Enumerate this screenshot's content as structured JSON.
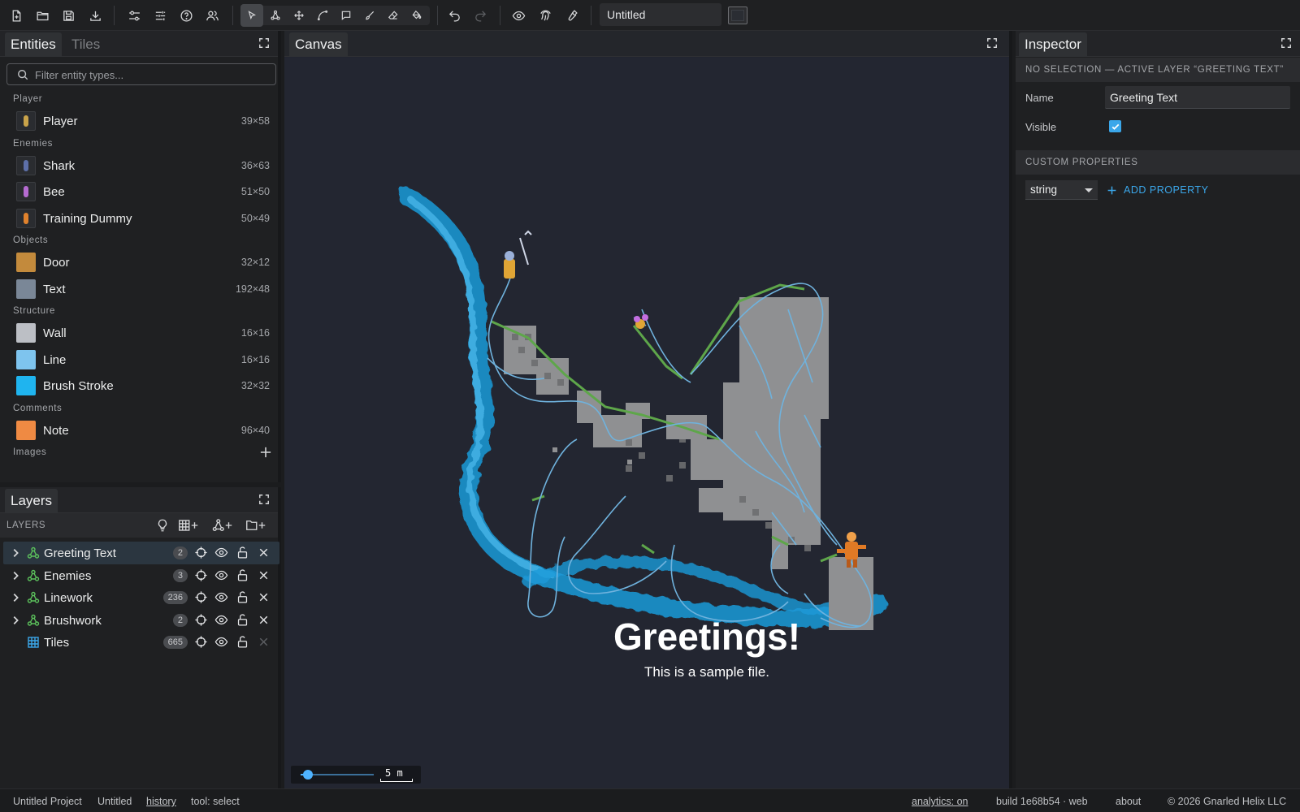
{
  "toolbar": {
    "document_name": "Untitled",
    "icons": [
      "new-file-icon",
      "open-folder-icon",
      "save-icon",
      "download-icon",
      "sliders-icon",
      "tune-icon",
      "help-icon",
      "users-icon",
      "select-pointer-icon",
      "node-tool-icon",
      "pan-icon",
      "curve-tool-icon",
      "comment-tool-icon",
      "brush-icon",
      "eraser-icon",
      "fill-icon",
      "undo-icon",
      "redo-icon",
      "eye-icon",
      "fingerprint-icon",
      "wrench-icon"
    ],
    "active_tool": "select"
  },
  "entities_panel": {
    "tabs": [
      {
        "label": "Entities",
        "active": true
      },
      {
        "label": "Tiles",
        "active": false
      }
    ],
    "filter_placeholder": "Filter entity types...",
    "categories": [
      {
        "label": "Player",
        "items": [
          {
            "name": "Player",
            "size": "39×58",
            "thumb": "sprite",
            "color": "#c9a34a"
          }
        ]
      },
      {
        "label": "Enemies",
        "items": [
          {
            "name": "Shark",
            "size": "36×63",
            "thumb": "sprite",
            "color": "#5d6fa8"
          },
          {
            "name": "Bee",
            "size": "51×50",
            "thumb": "sprite",
            "color": "#b56bd1"
          },
          {
            "name": "Training Dummy",
            "size": "50×49",
            "thumb": "sprite",
            "color": "#e0822d"
          }
        ]
      },
      {
        "label": "Objects",
        "items": [
          {
            "name": "Door",
            "size": "32×12",
            "thumb": "swatch",
            "color": "#c38a3c"
          },
          {
            "name": "Text",
            "size": "192×48",
            "thumb": "swatch",
            "color": "#7a8797"
          }
        ]
      },
      {
        "label": "Structure",
        "items": [
          {
            "name": "Wall",
            "size": "16×16",
            "thumb": "swatch",
            "color": "#bcbfc5"
          },
          {
            "name": "Line",
            "size": "16×16",
            "thumb": "swatch",
            "color": "#7ec4ee"
          },
          {
            "name": "Brush Stroke",
            "size": "32×32",
            "thumb": "swatch",
            "color": "#1fb4ef"
          }
        ]
      },
      {
        "label": "Comments",
        "items": [
          {
            "name": "Note",
            "size": "96×40",
            "thumb": "swatch",
            "color": "#ef8a43"
          }
        ]
      },
      {
        "label": "Images",
        "items": []
      }
    ]
  },
  "layers_panel": {
    "title": "Layers",
    "heading": "LAYERS",
    "layers": [
      {
        "name": "Greeting Text",
        "count": "2",
        "type": "entity",
        "active": true,
        "deletable": true,
        "expandable": true
      },
      {
        "name": "Enemies",
        "count": "3",
        "type": "entity",
        "active": false,
        "deletable": true,
        "expandable": true
      },
      {
        "name": "Linework",
        "count": "236",
        "type": "entity",
        "active": false,
        "deletable": true,
        "expandable": true
      },
      {
        "name": "Brushwork",
        "count": "2",
        "type": "entity",
        "active": false,
        "deletable": true,
        "expandable": true
      },
      {
        "name": "Tiles",
        "count": "665",
        "type": "tile",
        "active": false,
        "deletable": false,
        "expandable": false
      }
    ],
    "colors": {
      "entity_icon": "#5cc25c",
      "tile_icon": "#3ba7ea"
    }
  },
  "canvas": {
    "title": "Canvas",
    "greeting_title": "Greetings!",
    "greeting_subtitle": "This is a sample file.",
    "scale_label": "5 m",
    "zoom_level": 0.1
  },
  "inspector": {
    "title": "Inspector",
    "selection_status": "NO SELECTION — ACTIVE LAYER “GREETING TEXT”",
    "name_label": "Name",
    "name_value": "Greeting Text",
    "visible_label": "Visible",
    "visible_checked": true,
    "custom_properties_heading": "CUSTOM PROPERTIES",
    "property_type": "string",
    "add_property_label": "ADD PROPERTY",
    "accent": "#3ba7ea"
  },
  "status_bar": {
    "project": "Untitled Project",
    "document": "Untitled",
    "history": "history",
    "tool": "tool: select",
    "analytics": "analytics: on",
    "build": "build 1e68b54 · web",
    "about": "about",
    "copyright": "© 2026 Gnarled Helix LLC"
  }
}
